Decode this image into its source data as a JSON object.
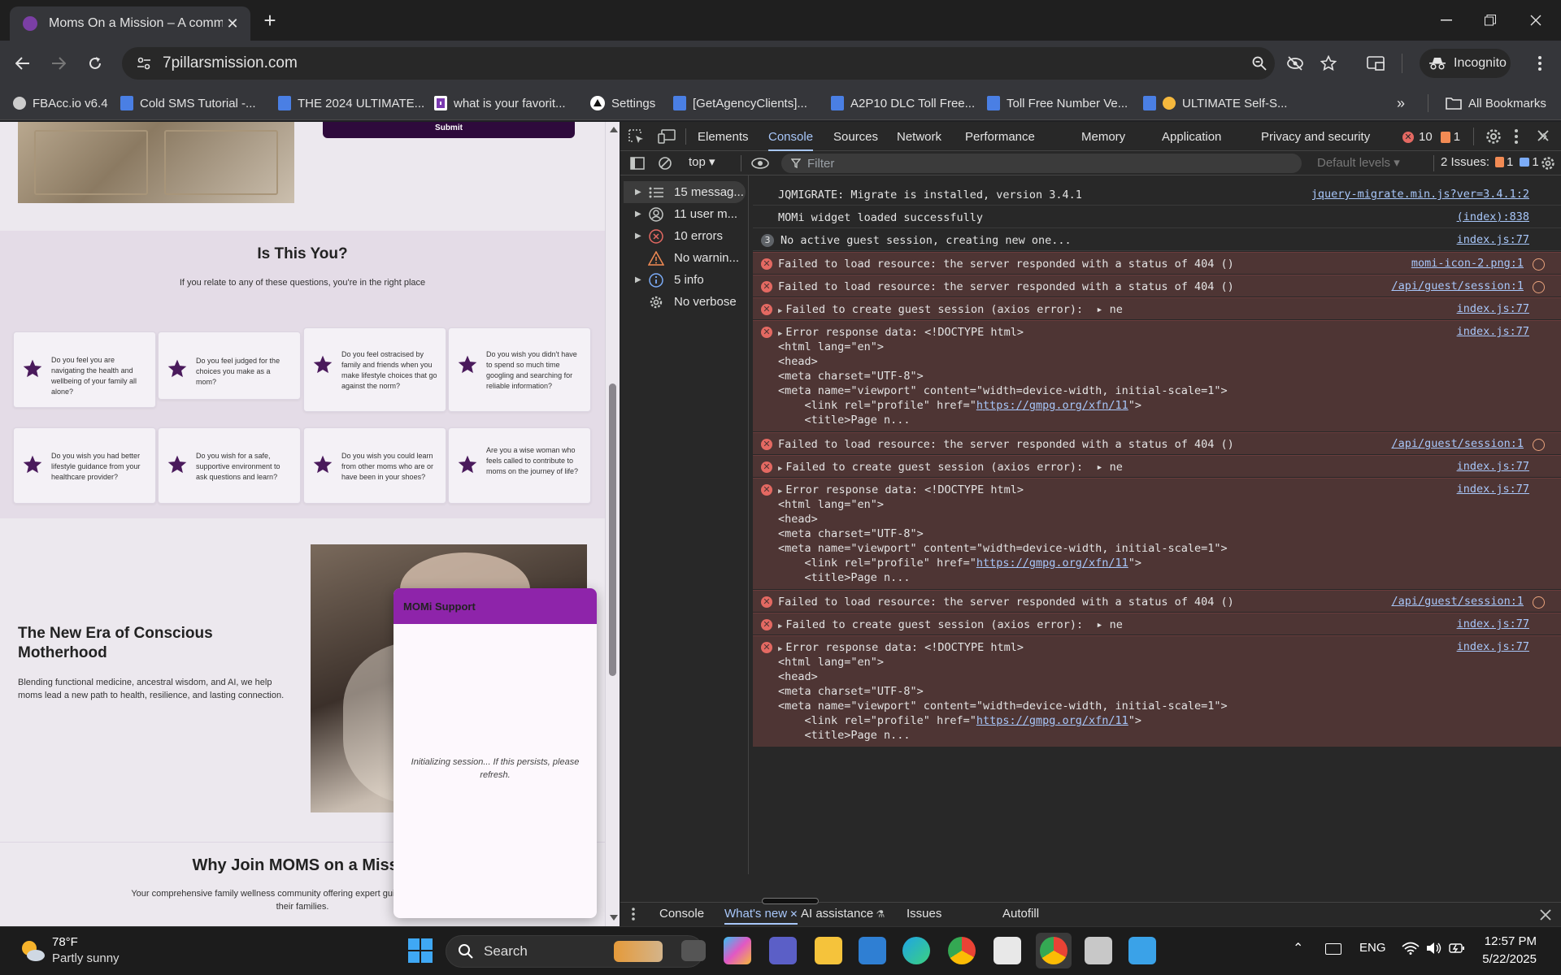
{
  "browser": {
    "tab_title": "Moms On a Mission – A community",
    "url": "7pillarsmission.com",
    "incognito_label": "Incognito",
    "bookmarks": [
      {
        "label": "FBAcc.io v6.4",
        "icon": "globe-icon"
      },
      {
        "label": "Cold SMS Tutorial -...",
        "icon": "doc-icon"
      },
      {
        "label": "THE 2024 ULTIMATE...",
        "icon": "doc-icon"
      },
      {
        "label": "what is your favorit...",
        "icon": "form-icon"
      },
      {
        "label": "Settings",
        "icon": "triangle-icon"
      },
      {
        "label": "[GetAgencyClients]...",
        "icon": "doc-icon"
      },
      {
        "label": "A2P10 DLC Toll Free...",
        "icon": "doc-icon"
      },
      {
        "label": "Toll Free Number Ve...",
        "icon": "doc-icon"
      },
      {
        "label": "ULTIMATE Self-S...",
        "icon": "doc-icon"
      }
    ],
    "all_bookmarks": "All Bookmarks"
  },
  "webpage": {
    "submit_label": "Submit",
    "is_this_you": {
      "title": "Is This You?",
      "subtitle": "If you relate to any of these questions, you're in the right place",
      "cards": [
        "Do you feel you are navigating the health and wellbeing of your family all alone?",
        "Do you feel judged for the choices you make as a mom?",
        "Do you feel ostracised by family and friends when you make lifestyle choices that go against the norm?",
        "Do you wish you didn't have to spend so much time googling and searching for reliable information?",
        "Do you wish you had better lifestyle guidance from your healthcare provider?",
        "Do you wish for a safe, supportive environment to ask questions and learn?",
        "Do you wish you could learn from other moms who are or have been in your shoes?",
        "Are you a wise woman who feels called to contribute to moms on the journey of life?"
      ]
    },
    "new_era": {
      "title": "The New Era of Conscious Motherhood",
      "body": "Blending functional medicine, ancestral wisdom, and AI, we help moms lead a new path to health, resilience, and lasting connection."
    },
    "why_join": {
      "title": "Why Join MOMS on a Missio",
      "body_line1": "Your comprehensive family wellness community offering expert guidance, support, and",
      "body_line2": "their families."
    },
    "widget": {
      "title": "MOMi Support",
      "status": "Initializing session... If this persists, please refresh."
    }
  },
  "devtools": {
    "tabs": [
      "Elements",
      "Console",
      "Sources",
      "Network",
      "Performance",
      "Memory",
      "Application",
      "Privacy and security"
    ],
    "active_tab": "Console",
    "error_count": "10",
    "warning_count": "1",
    "context": "top",
    "filter_placeholder": "Filter",
    "levels": "Default levels",
    "issues_label": "2 Issues:",
    "issues_warn": "1",
    "issues_info": "1",
    "sidebar": [
      {
        "label": "15 messag...",
        "icon": "list-icon",
        "expandable": true
      },
      {
        "label": "11 user m...",
        "icon": "user-icon",
        "expandable": true
      },
      {
        "label": "10 errors",
        "icon": "error-icon",
        "expandable": true
      },
      {
        "label": "No warnin...",
        "icon": "warning-icon",
        "expandable": false
      },
      {
        "label": "5 info",
        "icon": "info-icon",
        "expandable": true
      },
      {
        "label": "No verbose",
        "icon": "gear-icon",
        "expandable": false
      }
    ],
    "messages": [
      {
        "type": "log",
        "lines": [
          "JQMIGRATE: Migrate is installed, version 3.4.1"
        ],
        "src": "jquery-migrate.min.js?ver=3.4.1:2"
      },
      {
        "type": "log",
        "lines": [
          "MOMi widget loaded successfully"
        ],
        "src": "(index):838"
      },
      {
        "type": "log",
        "badge": "3",
        "lines": [
          "No active guest session, creating new one..."
        ],
        "src": "index.js:77"
      },
      {
        "type": "error",
        "lines": [
          "Failed to load resource: the server responded with a status of 404 ()"
        ],
        "src": "momi-icon-2.png:1",
        "net": true
      },
      {
        "type": "error",
        "lines": [
          "Failed to load resource: the server responded with a status of 404 ()"
        ],
        "src": "/api/guest/session:1",
        "net": true
      },
      {
        "type": "error",
        "expand": true,
        "lines": [
          "Failed to create guest session (axios error):  ▸ ne"
        ],
        "src": "index.js:77"
      },
      {
        "type": "error",
        "expand": true,
        "lines": [
          "Error response data: <!DOCTYPE html>",
          "<html lang=\"en\">",
          "<head>",
          "<meta charset=\"UTF-8\">",
          "<meta name=\"viewport\" content=\"width=device-width, initial-scale=1\">",
          "    <link rel=\"profile\" href=\"https://gmpg.org/xfn/11\">",
          "    <title>Page n..."
        ],
        "src": "index.js:77"
      },
      {
        "type": "error",
        "lines": [
          "Failed to load resource: the server responded with a status of 404 ()"
        ],
        "src": "/api/guest/session:1",
        "net": true
      },
      {
        "type": "error",
        "expand": true,
        "lines": [
          "Failed to create guest session (axios error):  ▸ ne"
        ],
        "src": "index.js:77"
      },
      {
        "type": "error",
        "expand": true,
        "lines": [
          "Error response data: <!DOCTYPE html>",
          "<html lang=\"en\">",
          "<head>",
          "<meta charset=\"UTF-8\">",
          "<meta name=\"viewport\" content=\"width=device-width, initial-scale=1\">",
          "    <link rel=\"profile\" href=\"https://gmpg.org/xfn/11\">",
          "    <title>Page n..."
        ],
        "src": "index.js:77"
      },
      {
        "type": "error",
        "lines": [
          "Failed to load resource: the server responded with a status of 404 ()"
        ],
        "src": "/api/guest/session:1",
        "net": true
      },
      {
        "type": "error",
        "expand": true,
        "lines": [
          "Failed to create guest session (axios error):  ▸ ne"
        ],
        "src": "index.js:77"
      },
      {
        "type": "error",
        "expand": true,
        "lines": [
          "Error response data: <!DOCTYPE html>",
          "<html lang=\"en\">",
          "<head>",
          "<meta charset=\"UTF-8\">",
          "<meta name=\"viewport\" content=\"width=device-width, initial-scale=1\">",
          "    <link rel=\"profile\" href=\"https://gmpg.org/xfn/11\">",
          "    <title>Page n..."
        ],
        "src": "index.js:77"
      }
    ],
    "drawer_tabs": [
      "Console",
      "What's new",
      "AI assistance",
      "Issues",
      "Autofill"
    ],
    "drawer_active": "What's new"
  },
  "taskbar": {
    "temp": "78°F",
    "weather": "Partly sunny",
    "search": "Search",
    "lang": "ENG",
    "time": "12:57 PM",
    "date": "5/22/2025"
  },
  "colors": {
    "accent": "#8e24aa",
    "error_bg": "#4e3534",
    "error_icon": "#e46962",
    "link": "#a8c7fa",
    "purple_dark": "#2e0a3c"
  }
}
